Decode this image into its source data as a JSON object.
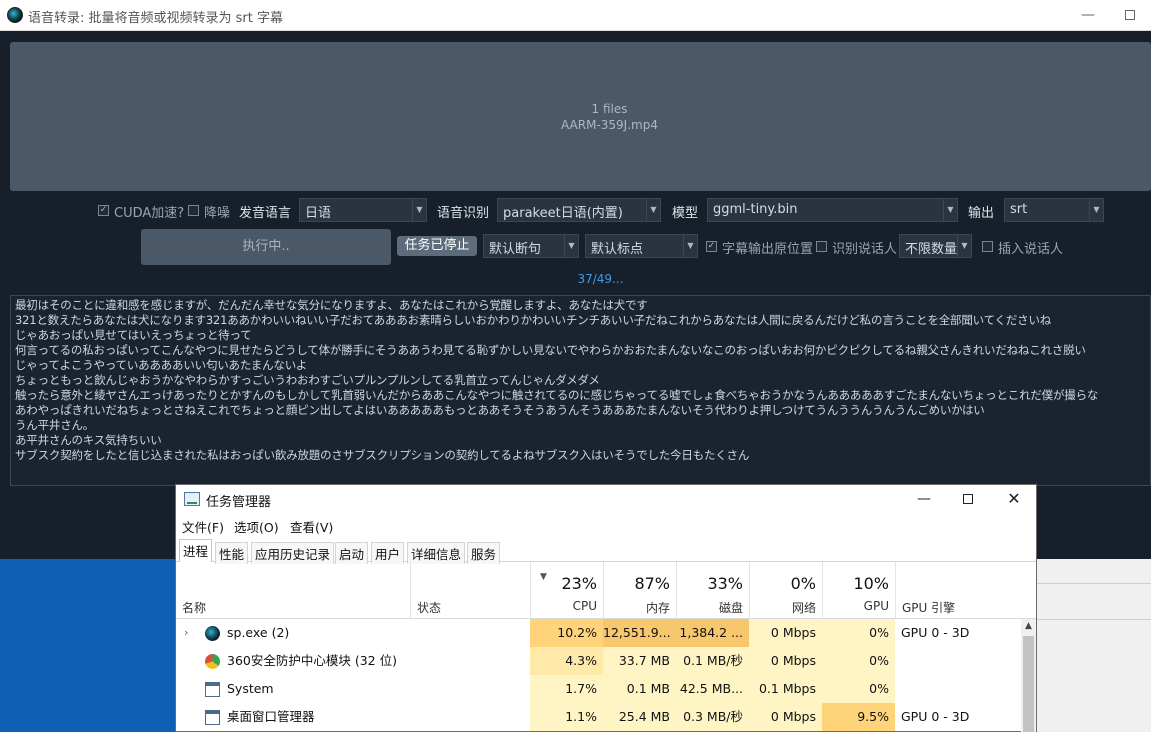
{
  "app": {
    "title": "语音转录: 批量将音频或视频转录为 srt 字幕",
    "drop_area": {
      "count": "1 files",
      "file": "AARM-359J.mp4"
    },
    "cuda_label": "CUDA加速?",
    "denoise_label": "降噪",
    "source_lang_label": "发音语言",
    "source_lang_value": "日语",
    "recognition_label": "语音识别",
    "recognition_value": "parakeet日语(内置)",
    "model_label": "模型",
    "model_value": "ggml-tiny.bin",
    "output_label": "输出",
    "output_value": "srt",
    "run_button": "执行中..",
    "stop_button": "任务已停止",
    "split_value": "默认断句",
    "punct_value": "默认标点",
    "keep_original_label": "字幕输出原位置",
    "speaker_label": "识别说话人",
    "speaker_count_value": "不限数量",
    "insert_speaker_label": "插入说话人",
    "progress": "37/49...",
    "output_lines": [
      "最初はそのことに違和感を感じますが、だんだん幸せな気分になりますよ、あなたはこれから覚醒しますよ、あなたは犬です",
      "321と数えたらあなたは犬になります321ああかわいいねいい子だおてあああお素晴らしいおかわりかわいいチンチあいい子だねこれからあなたは人間に戻るんだけど私の言うことを全部聞いてくださいね",
      "じゃあおっぱい見せてはいえっちょっと待って",
      "何言ってるの私おっぱいってこんなやつに見せたらどうして体が勝手にそうああうわ見てる恥ずかしい見ないでやわらかおおたまんないなこのおっぱいおお何かピクピクしてるね親父さんきれいだねねこれさ脱い",
      "じゃってよこうやっていああああいい匂いあたまんないよ",
      "ちょっともっと飲んじゃおうかなやわらかすっごいうわおわすごいプルンプルンしてる乳首立ってんじゃんダメダメ",
      "触ったら意外と綾ヤさんエっけあったりとかすんのもしかして乳首弱いんだからああこんなやつに触されてるのに感じちゃってる嘘でしょ食べちゃおうかなうんあああああすごたまんないちょっとこれだ僕が撮らな",
      "あわやっぱきれいだねちょっとさねえこれでちょっと顔ピン出してよはいあああああもっとああそうそうあうんそうあああたまんないそう代わりよ押しつけてうんううんうんうんごめいかはい",
      "うん平井さん。",
      "あ平井さんのキス気持ちいい",
      "サブスク契約をしたと信じ込まされた私はおっぱい飲み放題のさサブスクリプションの契約してるよねサブスク入はいそうでした今日もたくさん"
    ]
  },
  "task_manager": {
    "title": "任务管理器",
    "menu": [
      "文件(F)",
      "选项(O)",
      "查看(V)"
    ],
    "tabs": [
      "进程",
      "性能",
      "应用历史记录",
      "启动",
      "用户",
      "详细信息",
      "服务"
    ],
    "columns": {
      "name": "名称",
      "status": "状态",
      "cpu": {
        "pct": "23%",
        "label": "CPU"
      },
      "mem": {
        "pct": "87%",
        "label": "内存"
      },
      "disk": {
        "pct": "33%",
        "label": "磁盘"
      },
      "net": {
        "pct": "0%",
        "label": "网络"
      },
      "gpu": {
        "pct": "10%",
        "label": "GPU"
      },
      "gpu_engine": "GPU 引擎"
    },
    "rows": [
      {
        "name": "sp.exe (2)",
        "cpu": "10.2%",
        "mem": "12,551.9...",
        "disk": "1,384.2 ...",
        "net": "0 Mbps",
        "gpu": "0%",
        "engine": "GPU 0 - 3D",
        "icon": "app-icon"
      },
      {
        "name": "360安全防护中心模块 (32 位)",
        "cpu": "4.3%",
        "mem": "33.7 MB",
        "disk": "0.1 MB/秒",
        "net": "0 Mbps",
        "gpu": "0%",
        "engine": "",
        "icon": "360-icon"
      },
      {
        "name": "System",
        "cpu": "1.7%",
        "mem": "0.1 MB",
        "disk": "42.5 MB...",
        "net": "0.1 Mbps",
        "gpu": "0%",
        "engine": "",
        "icon": "window-icon"
      },
      {
        "name": "桌面窗口管理器",
        "cpu": "1.1%",
        "mem": "25.4 MB",
        "disk": "0.3 MB/秒",
        "net": "0 Mbps",
        "gpu": "9.5%",
        "engine": "GPU 0 - 3D",
        "icon": "window-icon"
      }
    ]
  }
}
